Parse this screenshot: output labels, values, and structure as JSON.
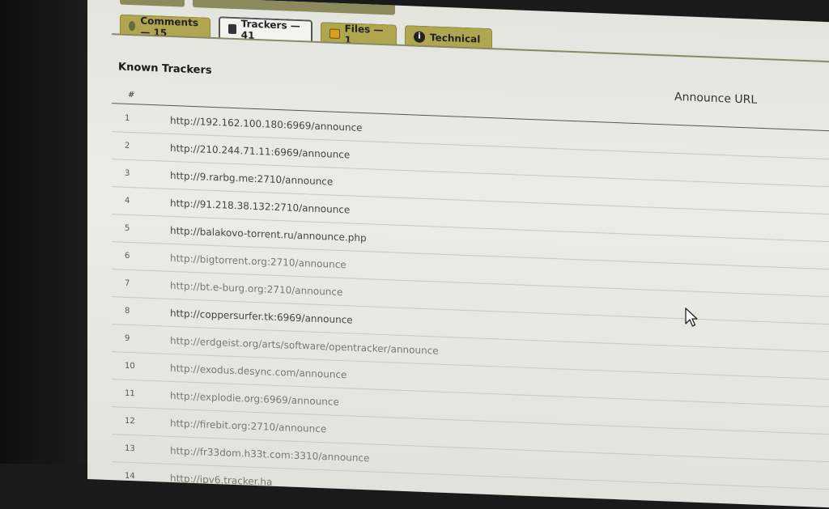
{
  "tabs": [
    {
      "label": "Comments — 15",
      "icon": "comments-icon",
      "active": false
    },
    {
      "label": "Trackers — 41",
      "icon": "trackers-icon",
      "active": true
    },
    {
      "label": "Files — 1",
      "icon": "files-icon",
      "active": false
    },
    {
      "label": "Technical",
      "icon": "info-icon",
      "active": false
    }
  ],
  "section": {
    "title": "Known Trackers",
    "col_num": "#",
    "col_url": "Announce URL"
  },
  "trackers": [
    {
      "n": "1",
      "url": "http://192.162.100.180:6969/announce"
    },
    {
      "n": "2",
      "url": "http://210.244.71.11:6969/announce"
    },
    {
      "n": "3",
      "url": "http://9.rarbg.me:2710/announce"
    },
    {
      "n": "4",
      "url": "http://91.218.38.132:2710/announce"
    },
    {
      "n": "5",
      "url": "http://balakovo-torrent.ru/announce.php"
    },
    {
      "n": "6",
      "url": "http://bigtorrent.org:2710/announce"
    },
    {
      "n": "7",
      "url": "http://bt.e-burg.org:2710/announce"
    },
    {
      "n": "8",
      "url": "http://coppersurfer.tk:6969/announce"
    },
    {
      "n": "9",
      "url": "http://erdgeist.org/arts/software/opentracker/announce"
    },
    {
      "n": "10",
      "url": "http://exodus.desync.com/announce"
    },
    {
      "n": "11",
      "url": "http://explodie.org:6969/announce"
    },
    {
      "n": "12",
      "url": "http://firebit.org:2710/announce"
    },
    {
      "n": "13",
      "url": "http://fr33dom.h33t.com:3310/announce"
    },
    {
      "n": "14",
      "url": "http://ipv6.tracker.ha"
    }
  ]
}
